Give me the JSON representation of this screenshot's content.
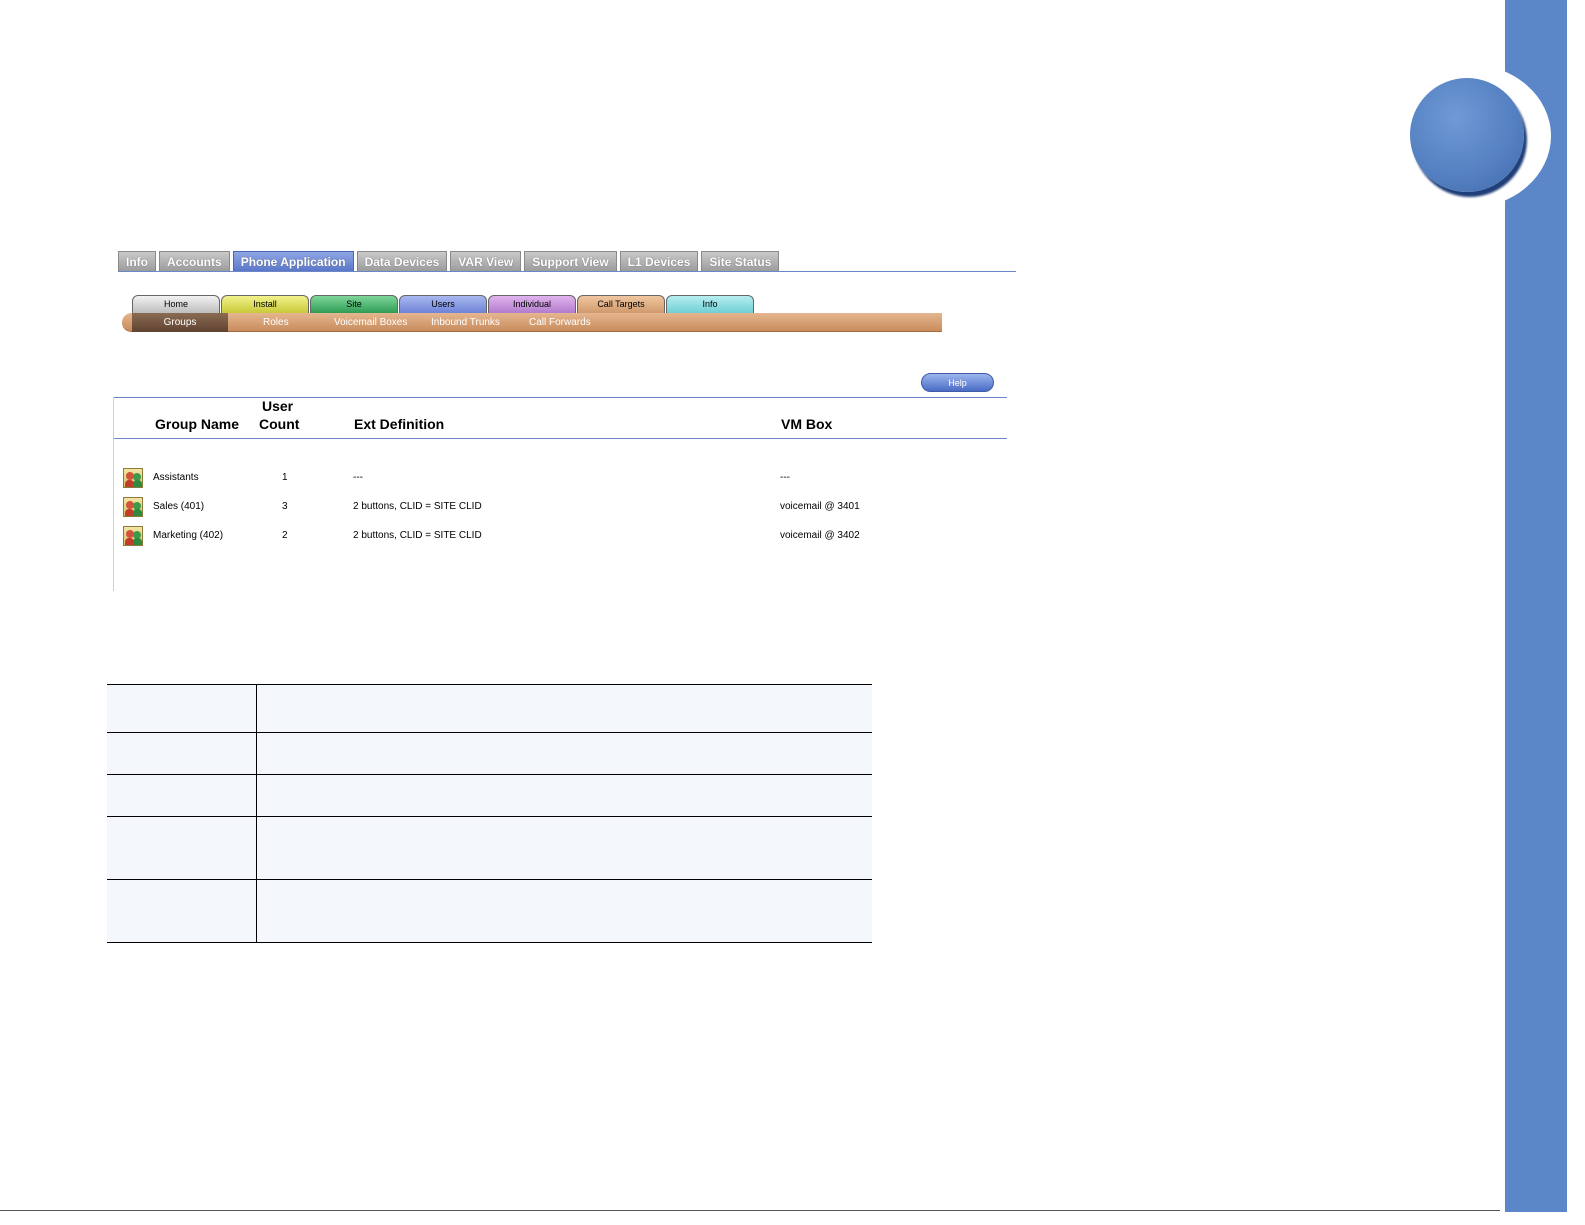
{
  "top_nav": {
    "tabs": [
      {
        "label": "Info"
      },
      {
        "label": "Accounts"
      },
      {
        "label": "Phone Application",
        "active": true
      },
      {
        "label": "Data Devices"
      },
      {
        "label": "VAR View"
      },
      {
        "label": "Support View"
      },
      {
        "label": "L1 Devices"
      },
      {
        "label": "Site Status"
      }
    ]
  },
  "section_tabs": [
    {
      "label": "Home"
    },
    {
      "label": "Install"
    },
    {
      "label": "Site"
    },
    {
      "label": "Users"
    },
    {
      "label": "Individual"
    },
    {
      "label": "Call Targets",
      "active": true
    },
    {
      "label": "Info"
    }
  ],
  "sub_tabs": [
    {
      "label": "Groups",
      "active": true
    },
    {
      "label": "Roles"
    },
    {
      "label": "Voicemail Boxes"
    },
    {
      "label": "Inbound Trunks"
    },
    {
      "label": "Call Forwards"
    }
  ],
  "help_label": "Help",
  "table": {
    "headers": {
      "group_name": "Group Name",
      "user_count_line1": "User",
      "user_count_line2": "Count",
      "ext_definition": "Ext Definition",
      "vm_box": "VM Box"
    },
    "rows": [
      {
        "icon": "group-icon",
        "name": "Assistants",
        "count": "1",
        "ext": "---",
        "vm": "---"
      },
      {
        "icon": "group-icon",
        "name": "Sales (401)",
        "count": "3",
        "ext": "2 buttons, CLID = SITE CLID",
        "vm": "voicemail @ 3401"
      },
      {
        "icon": "group-icon",
        "name": "Marketing (402)",
        "count": "2",
        "ext": "2 buttons, CLID = SITE CLID",
        "vm": "voicemail @ 3402"
      }
    ]
  },
  "colors": {
    "side_strip": "#5b87c8",
    "active_tab": "#5a77c9",
    "sub_bar": "#c88c5c"
  }
}
